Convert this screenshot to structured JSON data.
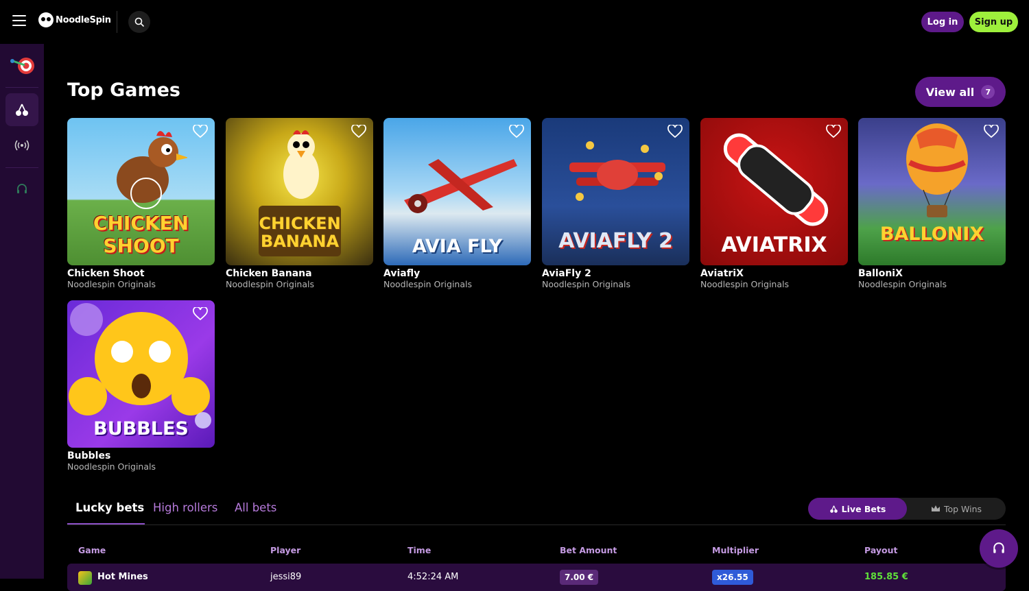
{
  "header": {
    "brand": "NoodleSpin",
    "login_label": "Log in",
    "signup_label": "Sign up"
  },
  "section": {
    "title": "Top Games",
    "view_all_label": "View all",
    "view_all_count": "7"
  },
  "games": [
    {
      "title": "Chicken Shoot",
      "subtitle": "Noodlespin Originals",
      "art_text": "CHICKEN SHOOT"
    },
    {
      "title": "Chicken Banana",
      "subtitle": "Noodlespin Originals",
      "art_text": "CHICKEN BANANA"
    },
    {
      "title": "Aviafly",
      "subtitle": "Noodlespin Originals",
      "art_text": "AVIA FLY"
    },
    {
      "title": "AviaFly 2",
      "subtitle": "Noodlespin Originals",
      "art_text": "AVIAFLY 2"
    },
    {
      "title": "AviatriX",
      "subtitle": "Noodlespin Originals",
      "art_text": "AVIATRIX"
    },
    {
      "title": "BalloniX",
      "subtitle": "Noodlespin Originals",
      "art_text": "BALLONIX"
    },
    {
      "title": "Bubbles",
      "subtitle": "Noodlespin Originals",
      "art_text": "BUBBLES"
    }
  ],
  "bets": {
    "tabs": [
      "Lucky bets",
      "High rollers",
      "All bets"
    ],
    "toggle": {
      "live": "Live Bets",
      "top": "Top Wins"
    },
    "columns": [
      "Game",
      "Player",
      "Time",
      "Bet Amount",
      "Multiplier",
      "Payout"
    ],
    "rows": [
      {
        "game": "Hot Mines",
        "player": "jessi89",
        "time": "4:52:24 AM",
        "bet": "7.00 €",
        "multiplier": "x26.55",
        "payout": "185.85 €"
      }
    ]
  },
  "colors": {
    "accent_purple": "#5e1a8a",
    "signup_green": "#9ef03c",
    "sidebar_bg": "#220a33",
    "payout_green": "#5fe03a",
    "multiplier_blue": "#2f5bd8"
  },
  "icons": {
    "menu": "hamburger-icon",
    "search": "search-icon",
    "heart": "heart-icon",
    "support": "headset-icon"
  }
}
